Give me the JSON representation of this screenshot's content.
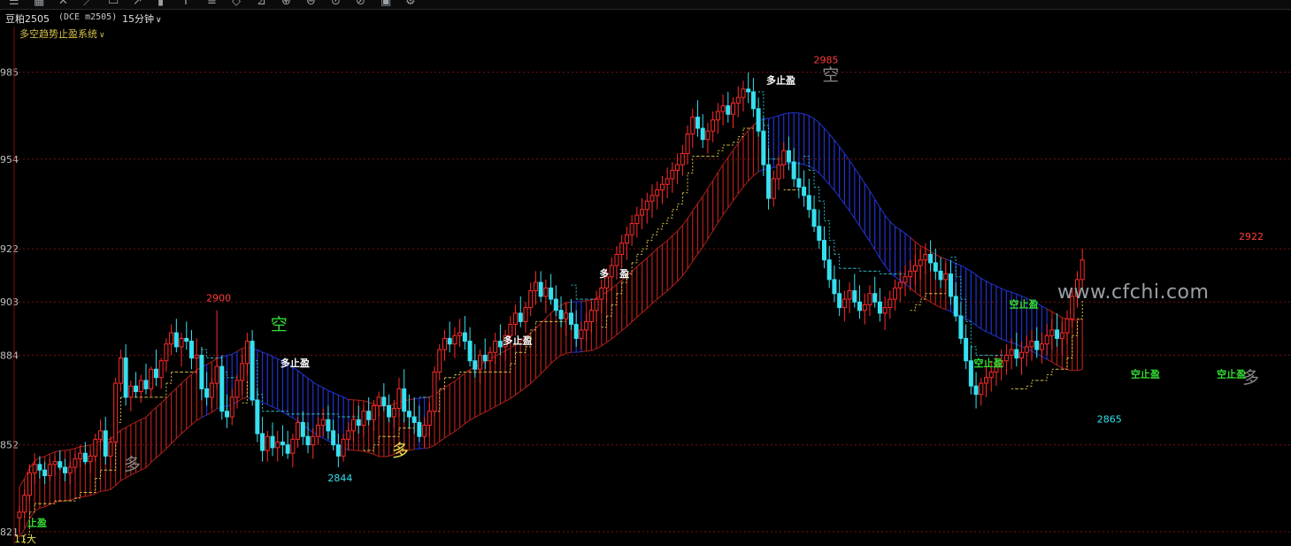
{
  "toolbar": {
    "icons": [
      "menu-icon",
      "grid-icon",
      "cross-icon",
      "line-icon",
      "rectangle-icon",
      "arrow-icon",
      "bar-icon",
      "text-icon",
      "channel-icon",
      "fib-icon",
      "measure-icon",
      "zoom-in-icon",
      "zoom-out-icon",
      "magnet-icon",
      "lock-icon",
      "trash-icon",
      "settings-icon"
    ]
  },
  "header": {
    "symbol_name": "豆粕2505",
    "market_code": "(DCE m2505)",
    "period": "15分钟",
    "indicator_name": "多空趋势止盈系统"
  },
  "footer": {
    "left_cap": "11大"
  },
  "watermark": "www.cfchi.com",
  "chart_data": {
    "type": "candlestick",
    "y_tick_labels": [
      "985",
      "954",
      "922",
      "903",
      "884",
      "852",
      "821"
    ],
    "y_ticks": [
      2985,
      2954,
      2922,
      2903,
      2884,
      2852,
      2821
    ],
    "ylim": [
      2820,
      2995
    ],
    "high_low_labels": [
      {
        "text": "2900",
        "value": 2900,
        "bar": 39,
        "kind": "high"
      },
      {
        "text": "2985",
        "value": 2985,
        "bar": 159,
        "kind": "high"
      },
      {
        "text": "2922",
        "value": 2922,
        "bar": 243,
        "kind": "high"
      },
      {
        "text": "2844",
        "value": 2844,
        "bar": 63,
        "kind": "low"
      },
      {
        "text": "2865",
        "value": 2865,
        "bar": 215,
        "kind": "low"
      }
    ],
    "text_annotations": [
      {
        "text": "多止盈",
        "bar": 54,
        "value": 2880,
        "color": "#ffffff"
      },
      {
        "text": "多止盈",
        "bar": 98,
        "value": 2888,
        "color": "#ffffff"
      },
      {
        "text": "多",
        "bar": 117,
        "value": 2912,
        "color": "#ffffff"
      },
      {
        "text": "盈",
        "bar": 121,
        "value": 2912,
        "color": "#ffffff"
      },
      {
        "text": "多止盈",
        "bar": 150,
        "value": 2981,
        "color": "#ffffff"
      },
      {
        "text": "空止盈",
        "bar": 198,
        "value": 2901,
        "color": "#33dd33"
      },
      {
        "text": "空止盈",
        "bar": 191,
        "value": 2880,
        "color": "#33dd33"
      },
      {
        "text": "空止盈",
        "bar": 222,
        "value": 2876,
        "color": "#33dd33"
      },
      {
        "text": "空止盈",
        "bar": 239,
        "value": 2876,
        "color": "#33dd33"
      },
      {
        "text": "止盈",
        "bar": 4,
        "value": 2823,
        "color": "#33dd33"
      }
    ],
    "signals": [
      {
        "text": "多",
        "bar": 22,
        "value": 2843,
        "color": "#888888"
      },
      {
        "text": "空",
        "bar": 51,
        "value": 2893,
        "color": "#33dd33"
      },
      {
        "text": "多",
        "bar": 75,
        "value": 2848,
        "color": "#e8e34a"
      },
      {
        "text": "空",
        "bar": 160,
        "value": 2982,
        "color": "#888888"
      },
      {
        "text": "多",
        "bar": 243,
        "value": 2874,
        "color": "#888888"
      }
    ],
    "candles": [
      [
        2826,
        2830,
        2821,
        2828
      ],
      [
        2828,
        2836,
        2826,
        2834
      ],
      [
        2834,
        2845,
        2832,
        2842
      ],
      [
        2842,
        2849,
        2838,
        2845
      ],
      [
        2845,
        2848,
        2840,
        2843
      ],
      [
        2843,
        2846,
        2838,
        2841
      ],
      [
        2841,
        2847,
        2839,
        2845
      ],
      [
        2845,
        2848,
        2841,
        2846
      ],
      [
        2846,
        2850,
        2843,
        2844
      ],
      [
        2844,
        2847,
        2839,
        2842
      ],
      [
        2842,
        2846,
        2838,
        2844
      ],
      [
        2844,
        2849,
        2842,
        2847
      ],
      [
        2847,
        2852,
        2844,
        2849
      ],
      [
        2849,
        2853,
        2845,
        2846
      ],
      [
        2846,
        2850,
        2842,
        2848
      ],
      [
        2848,
        2856,
        2846,
        2854
      ],
      [
        2854,
        2861,
        2850,
        2857
      ],
      [
        2857,
        2862,
        2845,
        2848
      ],
      [
        2848,
        2855,
        2844,
        2853
      ],
      [
        2853,
        2876,
        2852,
        2874
      ],
      [
        2874,
        2886,
        2871,
        2883
      ],
      [
        2883,
        2888,
        2866,
        2869
      ],
      [
        2869,
        2875,
        2864,
        2873
      ],
      [
        2873,
        2878,
        2869,
        2871
      ],
      [
        2871,
        2877,
        2867,
        2875
      ],
      [
        2875,
        2881,
        2870,
        2872
      ],
      [
        2872,
        2880,
        2869,
        2879
      ],
      [
        2879,
        2886,
        2873,
        2876
      ],
      [
        2876,
        2883,
        2872,
        2882
      ],
      [
        2882,
        2890,
        2878,
        2888
      ],
      [
        2888,
        2895,
        2884,
        2892
      ],
      [
        2892,
        2897,
        2885,
        2887
      ],
      [
        2887,
        2892,
        2880,
        2890
      ],
      [
        2890,
        2896,
        2886,
        2889
      ],
      [
        2889,
        2893,
        2879,
        2883
      ],
      [
        2883,
        2890,
        2877,
        2884
      ],
      [
        2884,
        2887,
        2868,
        2872
      ],
      [
        2872,
        2878,
        2866,
        2869
      ],
      [
        2869,
        2876,
        2865,
        2874
      ],
      [
        2874,
        2900,
        2872,
        2880
      ],
      [
        2880,
        2884,
        2861,
        2864
      ],
      [
        2864,
        2870,
        2858,
        2862
      ],
      [
        2862,
        2872,
        2859,
        2869
      ],
      [
        2869,
        2877,
        2865,
        2875
      ],
      [
        2875,
        2884,
        2870,
        2881
      ],
      [
        2881,
        2892,
        2877,
        2889
      ],
      [
        2889,
        2893,
        2866,
        2868
      ],
      [
        2868,
        2872,
        2853,
        2856
      ],
      [
        2856,
        2862,
        2846,
        2850
      ],
      [
        2850,
        2857,
        2846,
        2855
      ],
      [
        2855,
        2860,
        2848,
        2851
      ],
      [
        2851,
        2857,
        2846,
        2853
      ],
      [
        2853,
        2859,
        2848,
        2852
      ],
      [
        2852,
        2857,
        2847,
        2849
      ],
      [
        2849,
        2856,
        2844,
        2854
      ],
      [
        2854,
        2862,
        2851,
        2860
      ],
      [
        2860,
        2864,
        2852,
        2855
      ],
      [
        2855,
        2860,
        2849,
        2852
      ],
      [
        2852,
        2858,
        2847,
        2855
      ],
      [
        2855,
        2862,
        2852,
        2859
      ],
      [
        2859,
        2865,
        2855,
        2861
      ],
      [
        2861,
        2866,
        2854,
        2857
      ],
      [
        2857,
        2861,
        2850,
        2852
      ],
      [
        2852,
        2856,
        2844,
        2848
      ],
      [
        2848,
        2856,
        2846,
        2854
      ],
      [
        2854,
        2860,
        2850,
        2857
      ],
      [
        2857,
        2863,
        2853,
        2861
      ],
      [
        2861,
        2866,
        2856,
        2859
      ],
      [
        2859,
        2866,
        2855,
        2864
      ],
      [
        2864,
        2869,
        2859,
        2861
      ],
      [
        2861,
        2868,
        2857,
        2866
      ],
      [
        2866,
        2871,
        2862,
        2869
      ],
      [
        2869,
        2874,
        2864,
        2866
      ],
      [
        2866,
        2870,
        2860,
        2862
      ],
      [
        2862,
        2868,
        2858,
        2865
      ],
      [
        2865,
        2876,
        2862,
        2872
      ],
      [
        2872,
        2879,
        2860,
        2864
      ],
      [
        2864,
        2870,
        2858,
        2862
      ],
      [
        2862,
        2869,
        2856,
        2860
      ],
      [
        2860,
        2866,
        2853,
        2855
      ],
      [
        2855,
        2862,
        2851,
        2859
      ],
      [
        2859,
        2867,
        2855,
        2864
      ],
      [
        2864,
        2880,
        2862,
        2878
      ],
      [
        2878,
        2888,
        2875,
        2886
      ],
      [
        2886,
        2893,
        2882,
        2890
      ],
      [
        2890,
        2896,
        2885,
        2888
      ],
      [
        2888,
        2894,
        2883,
        2891
      ],
      [
        2891,
        2897,
        2887,
        2892
      ],
      [
        2892,
        2898,
        2886,
        2889
      ],
      [
        2889,
        2894,
        2880,
        2882
      ],
      [
        2882,
        2888,
        2876,
        2879
      ],
      [
        2879,
        2886,
        2874,
        2884
      ],
      [
        2884,
        2890,
        2879,
        2882
      ],
      [
        2882,
        2887,
        2878,
        2885
      ],
      [
        2885,
        2892,
        2881,
        2889
      ],
      [
        2889,
        2895,
        2884,
        2887
      ],
      [
        2887,
        2893,
        2882,
        2891
      ],
      [
        2891,
        2898,
        2887,
        2895
      ],
      [
        2895,
        2902,
        2891,
        2899
      ],
      [
        2899,
        2905,
        2894,
        2896
      ],
      [
        2896,
        2903,
        2892,
        2901
      ],
      [
        2901,
        2910,
        2898,
        2907
      ],
      [
        2907,
        2914,
        2902,
        2910
      ],
      [
        2910,
        2914,
        2903,
        2905
      ],
      [
        2905,
        2911,
        2899,
        2908
      ],
      [
        2908,
        2913,
        2902,
        2904
      ],
      [
        2904,
        2909,
        2898,
        2900
      ],
      [
        2900,
        2905,
        2894,
        2897
      ],
      [
        2897,
        2903,
        2891,
        2899
      ],
      [
        2899,
        2904,
        2893,
        2895
      ],
      [
        2895,
        2900,
        2887,
        2890
      ],
      [
        2890,
        2896,
        2886,
        2893
      ],
      [
        2893,
        2899,
        2889,
        2896
      ],
      [
        2896,
        2903,
        2892,
        2900
      ],
      [
        2900,
        2907,
        2896,
        2904
      ],
      [
        2904,
        2911,
        2899,
        2908
      ],
      [
        2908,
        2915,
        2903,
        2912
      ],
      [
        2912,
        2919,
        2907,
        2916
      ],
      [
        2916,
        2923,
        2911,
        2920
      ],
      [
        2920,
        2927,
        2915,
        2924
      ],
      [
        2924,
        2930,
        2918,
        2927
      ],
      [
        2927,
        2934,
        2923,
        2931
      ],
      [
        2931,
        2937,
        2926,
        2934
      ],
      [
        2934,
        2940,
        2929,
        2936
      ],
      [
        2936,
        2942,
        2931,
        2939
      ],
      [
        2939,
        2945,
        2933,
        2941
      ],
      [
        2941,
        2946,
        2936,
        2943
      ],
      [
        2943,
        2948,
        2938,
        2945
      ],
      [
        2945,
        2951,
        2940,
        2947
      ],
      [
        2947,
        2953,
        2942,
        2950
      ],
      [
        2950,
        2956,
        2945,
        2952
      ],
      [
        2952,
        2959,
        2948,
        2956
      ],
      [
        2956,
        2966,
        2952,
        2963
      ],
      [
        2963,
        2972,
        2958,
        2969
      ],
      [
        2969,
        2975,
        2962,
        2965
      ],
      [
        2965,
        2970,
        2958,
        2961
      ],
      [
        2961,
        2967,
        2956,
        2964
      ],
      [
        2964,
        2971,
        2960,
        2968
      ],
      [
        2968,
        2974,
        2963,
        2971
      ],
      [
        2971,
        2977,
        2966,
        2973
      ],
      [
        2973,
        2978,
        2967,
        2970
      ],
      [
        2970,
        2976,
        2965,
        2974
      ],
      [
        2974,
        2980,
        2969,
        2976
      ],
      [
        2976,
        2982,
        2971,
        2979
      ],
      [
        2979,
        2985,
        2974,
        2978
      ],
      [
        2978,
        2983,
        2969,
        2972
      ],
      [
        2972,
        2976,
        2962,
        2964
      ],
      [
        2964,
        2969,
        2948,
        2952
      ],
      [
        2952,
        2958,
        2936,
        2940
      ],
      [
        2940,
        2950,
        2937,
        2947
      ],
      [
        2947,
        2955,
        2943,
        2952
      ],
      [
        2952,
        2960,
        2947,
        2957
      ],
      [
        2957,
        2962,
        2950,
        2953
      ],
      [
        2953,
        2958,
        2944,
        2947
      ],
      [
        2947,
        2953,
        2940,
        2944
      ],
      [
        2944,
        2950,
        2937,
        2941
      ],
      [
        2941,
        2947,
        2933,
        2936
      ],
      [
        2936,
        2941,
        2928,
        2930
      ],
      [
        2930,
        2936,
        2922,
        2925
      ],
      [
        2925,
        2930,
        2915,
        2918
      ],
      [
        2918,
        2923,
        2908,
        2911
      ],
      [
        2911,
        2916,
        2903,
        2906
      ],
      [
        2906,
        2911,
        2898,
        2901
      ],
      [
        2901,
        2907,
        2896,
        2904
      ],
      [
        2904,
        2910,
        2899,
        2907
      ],
      [
        2907,
        2913,
        2901,
        2903
      ],
      [
        2903,
        2909,
        2897,
        2900
      ],
      [
        2900,
        2906,
        2895,
        2902
      ],
      [
        2902,
        2909,
        2898,
        2906
      ],
      [
        2906,
        2912,
        2901,
        2903
      ],
      [
        2903,
        2908,
        2896,
        2899
      ],
      [
        2899,
        2905,
        2893,
        2901
      ],
      [
        2901,
        2907,
        2897,
        2904
      ],
      [
        2904,
        2911,
        2900,
        2908
      ],
      [
        2908,
        2914,
        2903,
        2910
      ],
      [
        2910,
        2916,
        2905,
        2912
      ],
      [
        2912,
        2918,
        2907,
        2914
      ],
      [
        2914,
        2920,
        2909,
        2916
      ],
      [
        2916,
        2922,
        2911,
        2918
      ],
      [
        2918,
        2924,
        2913,
        2920
      ],
      [
        2920,
        2925,
        2914,
        2917
      ],
      [
        2917,
        2922,
        2911,
        2914
      ],
      [
        2914,
        2919,
        2908,
        2911
      ],
      [
        2911,
        2917,
        2906,
        2913
      ],
      [
        2913,
        2918,
        2902,
        2905
      ],
      [
        2905,
        2910,
        2896,
        2898
      ],
      [
        2898,
        2903,
        2888,
        2890
      ],
      [
        2890,
        2895,
        2879,
        2882
      ],
      [
        2882,
        2887,
        2870,
        2873
      ],
      [
        2873,
        2878,
        2865,
        2870
      ],
      [
        2870,
        2876,
        2866,
        2874
      ],
      [
        2874,
        2880,
        2869,
        2876
      ],
      [
        2876,
        2882,
        2871,
        2878
      ],
      [
        2878,
        2884,
        2873,
        2880
      ],
      [
        2880,
        2886,
        2875,
        2882
      ],
      [
        2882,
        2888,
        2877,
        2884
      ],
      [
        2884,
        2890,
        2879,
        2886
      ],
      [
        2886,
        2892,
        2880,
        2883
      ],
      [
        2883,
        2889,
        2877,
        2885
      ],
      [
        2885,
        2891,
        2880,
        2887
      ],
      [
        2887,
        2893,
        2882,
        2889
      ],
      [
        2889,
        2894,
        2883,
        2886
      ],
      [
        2886,
        2892,
        2881,
        2888
      ],
      [
        2888,
        2895,
        2884,
        2891
      ],
      [
        2891,
        2897,
        2886,
        2893
      ],
      [
        2893,
        2899,
        2887,
        2890
      ],
      [
        2890,
        2896,
        2884,
        2892
      ],
      [
        2892,
        2900,
        2888,
        2897
      ],
      [
        2897,
        2908,
        2894,
        2905
      ],
      [
        2905,
        2914,
        2901,
        2911
      ],
      [
        2911,
        2922,
        2907,
        2918
      ]
    ]
  }
}
